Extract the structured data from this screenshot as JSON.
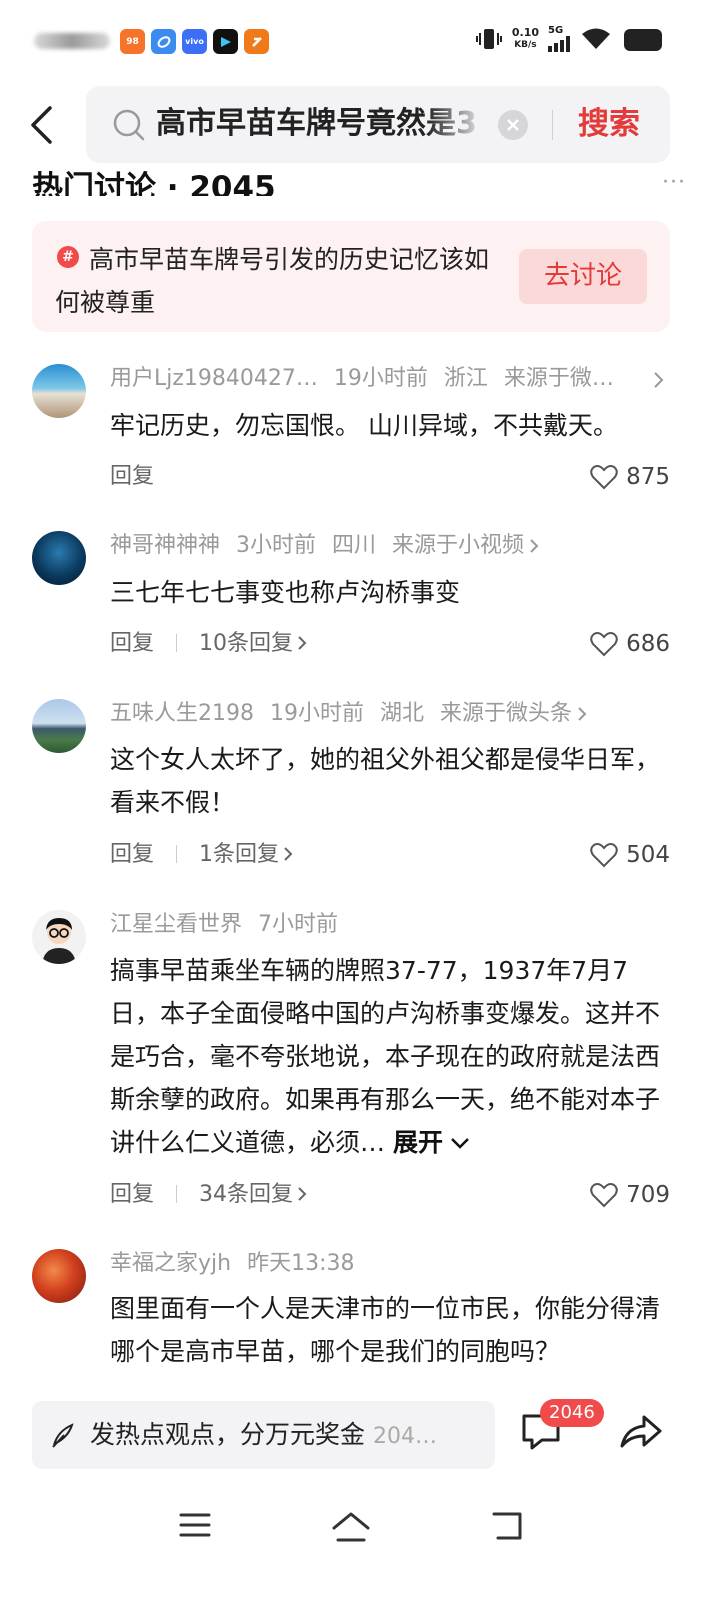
{
  "status_bar": {
    "net_speed_value": "0.10",
    "net_speed_unit": "KB/s",
    "network": "5G",
    "app_icons": [
      {
        "name": "app-icon-1",
        "label": "98",
        "color": "#f5742a"
      },
      {
        "name": "app-icon-2",
        "label": "",
        "color": "#3b8bf0"
      },
      {
        "name": "app-icon-3",
        "label": "vivo",
        "color": "#3c6ff5"
      },
      {
        "name": "app-icon-4",
        "label": "",
        "color": "#111111"
      },
      {
        "name": "app-icon-5",
        "label": "",
        "color": "#f07a1a"
      }
    ]
  },
  "header": {
    "search_query": "高市早苗车牌号竟然是3",
    "search_button": "搜索"
  },
  "section": {
    "title": "热门讨论 · 2045",
    "more": "···"
  },
  "topic": {
    "badge": "#",
    "text": "高市早苗车牌号引发的历史记忆该如何被尊重",
    "button": "去讨论"
  },
  "comments": [
    {
      "user": "用户Ljz19840427…",
      "time": "19小时前",
      "region": "浙江",
      "source": "来源于微…",
      "body": "牢记历史，勿忘国恨。 山川异域，不共戴天。",
      "reply": "回复",
      "replies": "",
      "likes": "875"
    },
    {
      "user": "神哥神神神",
      "time": "3小时前",
      "region": "四川",
      "source": "来源于小视频",
      "body": "三七年七七事变也称卢沟桥事变",
      "reply": "回复",
      "replies": "10条回复",
      "likes": "686"
    },
    {
      "user": "五味人生2198",
      "time": "19小时前",
      "region": "湖北",
      "source": "来源于微头条",
      "body": "这个女人太坏了，她的祖父外祖父都是侵华日军，看来不假！",
      "reply": "回复",
      "replies": "1条回复",
      "likes": "504"
    },
    {
      "user": "江星尘看世界",
      "time": "7小时前",
      "region": "",
      "source": "",
      "body": "搞事早苗乘坐车辆的牌照37-77，1937年7月7日，本子全面侵略中国的卢沟桥事变爆发。这并不是巧合，毫不夸张地说，本子现在的政府就是法西斯余孽的政府。如果再有那么一天，绝不能对本子讲什么仁义道德，必须…",
      "expand": "展开",
      "reply": "回复",
      "replies": "34条回复",
      "likes": "709"
    },
    {
      "user": "幸福之家yjh",
      "time": "昨天13:38",
      "region": "",
      "source": "",
      "body": "图里面有一个人是天津市的一位市民，你能分得清哪个是高市早苗，哪个是我们的同胞吗？"
    }
  ],
  "bottom_bar": {
    "post_placeholder": "发热点观点，分万元奖金",
    "post_count": "204…",
    "comment_badge": "2046"
  }
}
